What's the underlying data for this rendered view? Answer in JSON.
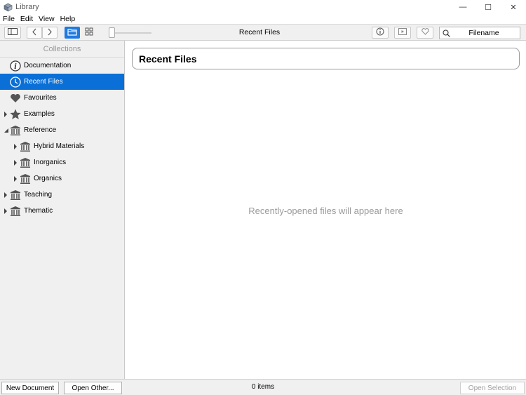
{
  "window": {
    "title": "Library",
    "minimize_glyph": "—",
    "maximize_glyph": "☐",
    "close_glyph": "✕"
  },
  "menu": [
    "File",
    "Edit",
    "View",
    "Help"
  ],
  "toolbar": {
    "title": "Recent Files",
    "search_placeholder": "Filename"
  },
  "sidebar": {
    "header": "Collections",
    "items": [
      {
        "label": "Documentation",
        "icon": "info-icon"
      },
      {
        "label": "Recent Files",
        "icon": "clock-icon",
        "selected": true
      },
      {
        "label": "Favourites",
        "icon": "heart-icon"
      },
      {
        "label": "Examples",
        "icon": "star-icon",
        "expandable": true
      },
      {
        "label": "Reference",
        "icon": "building-icon",
        "expanded": true
      },
      {
        "label": "Hybrid Materials",
        "icon": "building-icon",
        "expandable": true,
        "child": true
      },
      {
        "label": "Inorganics",
        "icon": "building-icon",
        "expandable": true,
        "child": true
      },
      {
        "label": "Organics",
        "icon": "building-icon",
        "expandable": true,
        "child": true
      },
      {
        "label": "Teaching",
        "icon": "building-icon",
        "expandable": true
      },
      {
        "label": "Thematic",
        "icon": "building-icon",
        "expandable": true
      }
    ]
  },
  "content": {
    "heading": "Recent Files",
    "empty_message": "Recently-opened files will appear here"
  },
  "statusbar": {
    "new_document": "New Document",
    "open_other": "Open Other...",
    "item_count": "0 items",
    "open_selection": "Open Selection"
  },
  "colors": {
    "accent": "#1f7ae0",
    "selection": "#0a6fd6",
    "icon_gray": "#555555"
  }
}
